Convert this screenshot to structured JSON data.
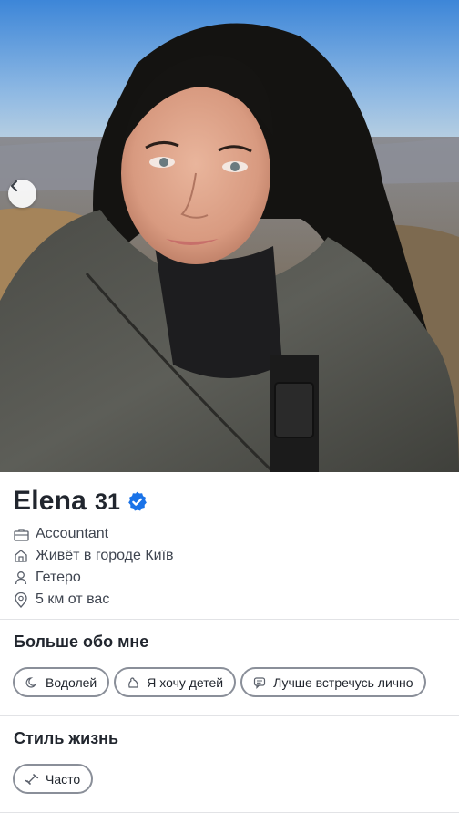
{
  "profile": {
    "name": "Elena",
    "age": "31",
    "verified_icon": "verified-badge-icon",
    "accent_color": "#1a73e8"
  },
  "info": [
    {
      "icon": "briefcase-icon",
      "text": "Accountant"
    },
    {
      "icon": "home-icon",
      "text": "Живёт в городе Київ"
    },
    {
      "icon": "person-icon",
      "text": "Гетеро"
    },
    {
      "icon": "location-pin-icon",
      "text": "5 км от вас"
    }
  ],
  "about": {
    "title": "Больше обо мне",
    "chips": [
      {
        "icon": "zodiac-icon",
        "text": "Водолей"
      },
      {
        "icon": "baby-icon",
        "text": "Я хочу детей"
      },
      {
        "icon": "chat-icon",
        "text": "Лучше встречусь лично"
      }
    ]
  },
  "lifestyle": {
    "title": "Стиль жизнь",
    "chips": [
      {
        "icon": "dumbbell-icon",
        "text": "Часто"
      }
    ]
  }
}
